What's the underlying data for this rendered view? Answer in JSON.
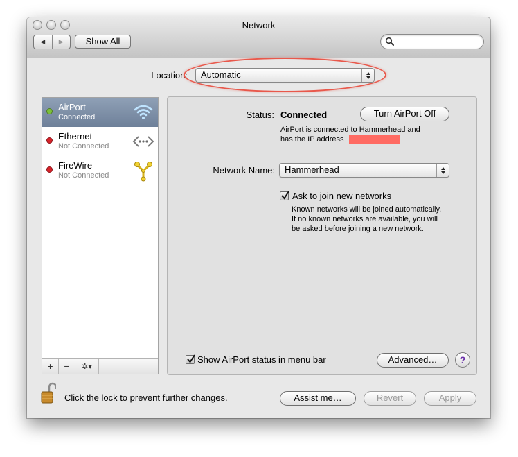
{
  "window": {
    "title": "Network"
  },
  "toolbar": {
    "back_glyph": "◀",
    "forward_glyph": "▶",
    "show_all_label": "Show All",
    "search_placeholder": ""
  },
  "location": {
    "label": "Location:",
    "value": "Automatic"
  },
  "services": [
    {
      "name": "AirPort",
      "status": "Connected",
      "dot_color": "#7cc13a",
      "icon": "wifi-icon",
      "selected": true
    },
    {
      "name": "Ethernet",
      "status": "Not Connected",
      "dot_color": "#d8232a",
      "icon": "ethernet-icon",
      "selected": false
    },
    {
      "name": "FireWire",
      "status": "Not Connected",
      "dot_color": "#d8232a",
      "icon": "firewire-icon",
      "selected": false
    }
  ],
  "sidebar_tools": {
    "add": "+",
    "remove": "−",
    "action": "✲▾"
  },
  "airport_pane": {
    "status_label": "Status:",
    "status_value": "Connected",
    "turn_off_label": "Turn AirPort Off",
    "status_line1": "AirPort is connected to Hammerhead and",
    "status_line2": "has the IP address",
    "network_name_label": "Network Name:",
    "network_name_value": "Hammerhead",
    "ask_to_join_label": "Ask to join new networks",
    "ask_to_join_checked": true,
    "help_line1": "Known networks will be joined automatically.",
    "help_line2": "If no known networks are available, you will",
    "help_line3": "be asked before joining a new network.",
    "show_status_label": "Show AirPort status in menu bar",
    "show_status_checked": true,
    "advanced_label": "Advanced…",
    "help_glyph": "?"
  },
  "footer": {
    "lock_text": "Click the lock to prevent further changes.",
    "assist_label": "Assist me…",
    "revert_label": "Revert",
    "apply_label": "Apply"
  },
  "colors": {
    "annotation_ellipse": "#e8584b",
    "redaction": "#ff6b63",
    "selection": "#7c8da5"
  }
}
